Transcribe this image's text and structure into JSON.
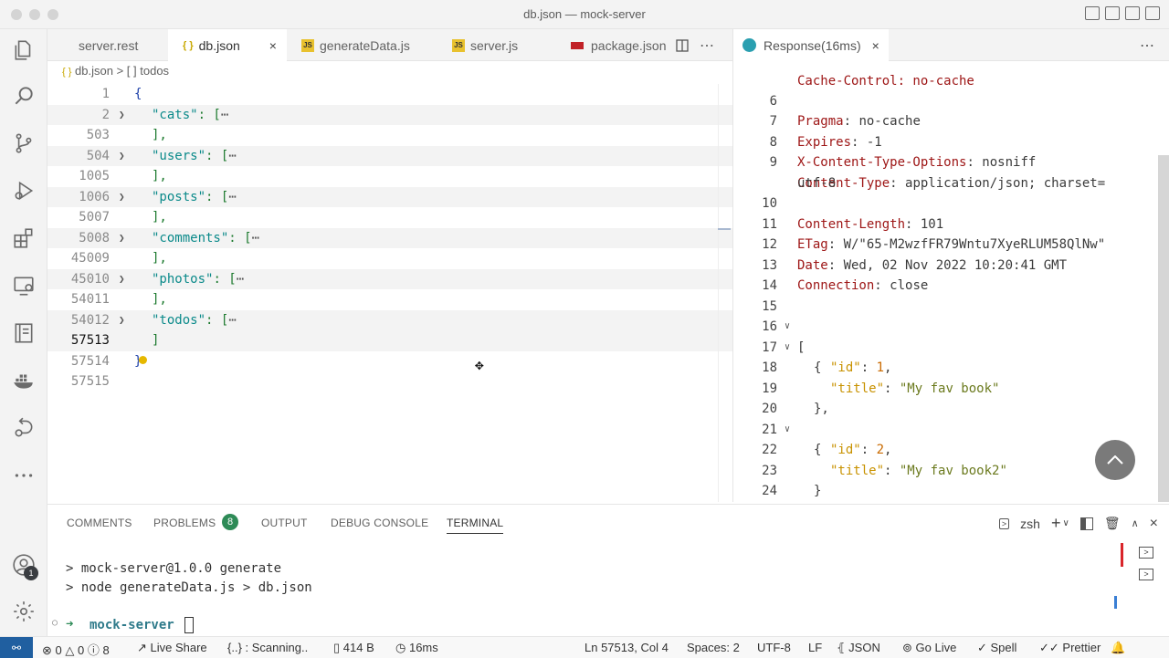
{
  "window": {
    "title": "db.json — mock-server"
  },
  "tabs": [
    {
      "label": "server.rest",
      "icon": "none"
    },
    {
      "label": "db.json",
      "icon": "json"
    },
    {
      "label": "generateData.js",
      "icon": "js"
    },
    {
      "label": "server.js",
      "icon": "js"
    },
    {
      "label": "package.json",
      "icon": "npm"
    }
  ],
  "breadcrumb": {
    "file": "db.json",
    "separator": ">",
    "node": "[ ] todos",
    "file_icon": "{ }"
  },
  "editor": {
    "lines": [
      {
        "n": "1"
      },
      {
        "n": "2",
        "key": "\"cats\""
      },
      {
        "n": "503"
      },
      {
        "n": "504",
        "key": "\"users\""
      },
      {
        "n": "1005"
      },
      {
        "n": "1006",
        "key": "\"posts\""
      },
      {
        "n": "5007"
      },
      {
        "n": "5008",
        "key": "\"comments\""
      },
      {
        "n": "45009"
      },
      {
        "n": "45010",
        "key": "\"photos\""
      },
      {
        "n": "54011"
      },
      {
        "n": "54012",
        "key": "\"todos\""
      },
      {
        "n": "57513"
      },
      {
        "n": "57514"
      },
      {
        "n": "57515"
      }
    ],
    "open_brace": "{",
    "close_brace": "}",
    "close_bracket_comma": "],",
    "close_bracket": "]",
    "colon_bracket": ": [",
    "ellipsis": "⋯"
  },
  "response": {
    "tab_label": "Response(16ms)",
    "top_partial": "Cache-Control: no-cache",
    "headers": [
      {
        "n": "6",
        "k": "Pragma",
        "v": "no-cache"
      },
      {
        "n": "7",
        "k": "Expires",
        "v": "-1"
      },
      {
        "n": "8",
        "k": "X-Content-Type-Options",
        "v": "nosniff"
      },
      {
        "n": "9",
        "k": "Content-Type",
        "v": "application/json; charset="
      },
      {
        "n": "",
        "k": "",
        "v": "utf-8"
      },
      {
        "n": "10",
        "k": "Content-Length",
        "v": "101"
      },
      {
        "n": "11",
        "k": "ETag",
        "v": "W/\"65-M2wzfFR79Wntu7XyeRLUM58QlNw\""
      },
      {
        "n": "12",
        "k": "Date",
        "v": "Wed, 02 Nov 2022 10:20:41 GMT"
      },
      {
        "n": "13",
        "k": "Connection",
        "v": "close"
      }
    ],
    "body_line_numbers": [
      "14",
      "15",
      "16",
      "17",
      "18",
      "19",
      "20",
      "21",
      "22",
      "23",
      "24"
    ],
    "items": [
      {
        "id_key": "\"id\"",
        "id": "1",
        "title_key": "\"title\"",
        "title": "\"My fav book\""
      },
      {
        "id_key": "\"id\"",
        "id": "2",
        "title_key": "\"title\"",
        "title": "\"My fav book2\""
      }
    ],
    "open_array": "[",
    "close_array": "]",
    "open_obj": "{",
    "close_obj_comma": "},",
    "close_obj": "}"
  },
  "panel": {
    "tabs": [
      "COMMENTS",
      "PROBLEMS",
      "OUTPUT",
      "DEBUG CONSOLE",
      "TERMINAL"
    ],
    "problems_count": "8",
    "terminal_shell": "zsh",
    "terminal_lines": [
      "> mock-server@1.0.0 generate",
      "> node generateData.js > db.json"
    ],
    "prompt": "mock-server"
  },
  "status": {
    "errors": "0",
    "warnings": "0",
    "info": "8",
    "live_share": "Live Share",
    "scanning": "{..} : Scanning..",
    "size": "414 B",
    "time": "16ms",
    "position": "Ln 57513, Col 4",
    "spaces": "Spaces: 2",
    "encoding": "UTF-8",
    "eol": "LF",
    "language": "JSON",
    "go_live": "Go Live",
    "spell": "Spell",
    "prettier": "Prettier"
  },
  "activity_badge": "1"
}
